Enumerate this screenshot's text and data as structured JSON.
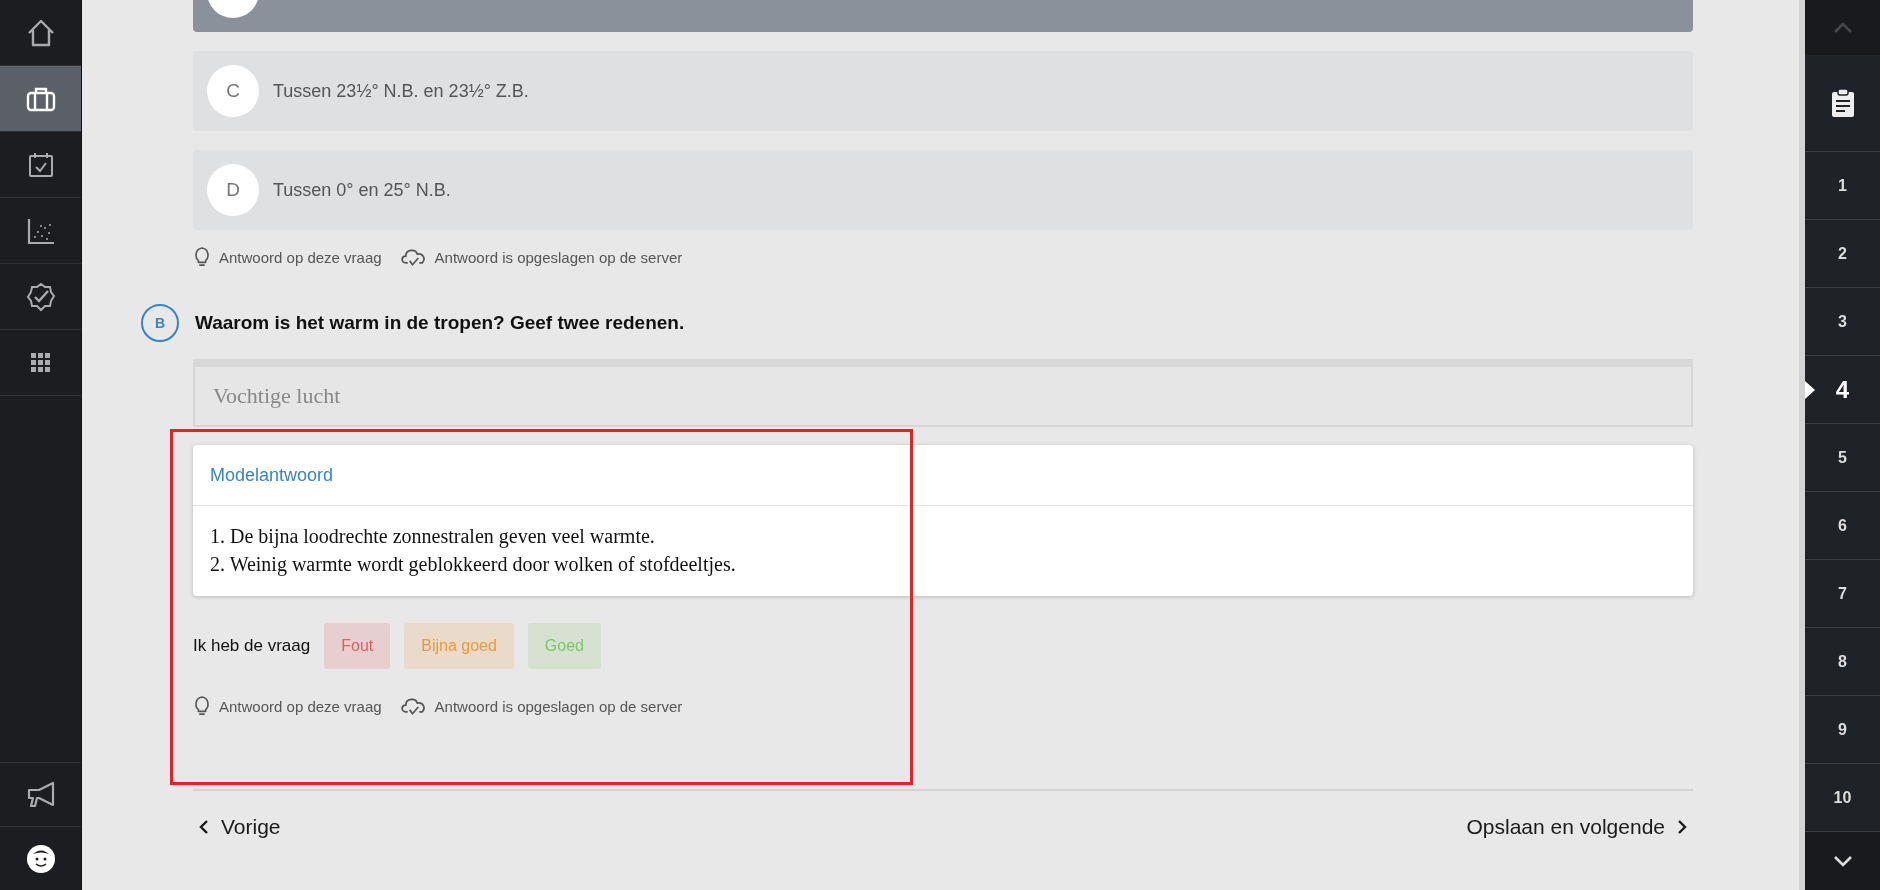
{
  "sidebar": {
    "items": [
      {
        "kind": "home",
        "selected": false
      },
      {
        "kind": "briefcase",
        "selected": true
      },
      {
        "kind": "calendar",
        "selected": false
      },
      {
        "kind": "chart",
        "selected": false
      },
      {
        "kind": "badge",
        "selected": false
      },
      {
        "kind": "grid",
        "selected": false
      }
    ],
    "bottom_items": [
      {
        "kind": "megaphone"
      },
      {
        "kind": "avatar"
      }
    ]
  },
  "question_a": {
    "options": [
      {
        "selected": true
      },
      {
        "letter": "C",
        "text": "Tussen 23½° N.B. en 23½° Z.B.",
        "selected": false
      },
      {
        "letter": "D",
        "text": "Tussen 0° en 25° N.B.",
        "selected": false
      }
    ],
    "hints": [
      {
        "kind": "lightbulb",
        "text": "Antwoord op deze vraag"
      },
      {
        "kind": "cloud",
        "text": "Antwoord is opgeslagen op de server"
      }
    ]
  },
  "question_b": {
    "label": "B",
    "text": "Waarom is het warm in de tropen? Geef twee redenen.",
    "answer": "Vochtige lucht",
    "model_answer": {
      "title": "Modelantwoord",
      "lines": [
        "1. De bijna loodrechte zonnestralen geven veel warmte.",
        "2. Weinig warmte wordt geblokkeerd door wolken of stofdeeltjes."
      ]
    },
    "rating": {
      "label": "Ik heb de vraag",
      "buttons": [
        {
          "label": "Fout",
          "color": "#e35d5d"
        },
        {
          "label": "Bijna goed",
          "color": "#ee9a3a"
        },
        {
          "label": "Goed",
          "color": "#7cc767"
        }
      ]
    },
    "hints": [
      {
        "kind": "lightbulb",
        "text": "Antwoord op deze vraag"
      },
      {
        "kind": "cloud",
        "text": "Antwoord is opgeslagen op de server"
      }
    ]
  },
  "nav": {
    "previous": "Vorige",
    "next": "Opslaan en volgende"
  },
  "question_nav": {
    "items": [
      {
        "label": "1",
        "selected": false
      },
      {
        "label": "2",
        "selected": false
      },
      {
        "label": "3",
        "selected": false
      },
      {
        "label": "4",
        "selected": true
      },
      {
        "label": "5",
        "selected": false
      },
      {
        "label": "6",
        "selected": false
      },
      {
        "label": "7",
        "selected": false
      },
      {
        "label": "8",
        "selected": false
      },
      {
        "label": "9",
        "selected": false
      },
      {
        "label": "10",
        "selected": false
      }
    ]
  }
}
